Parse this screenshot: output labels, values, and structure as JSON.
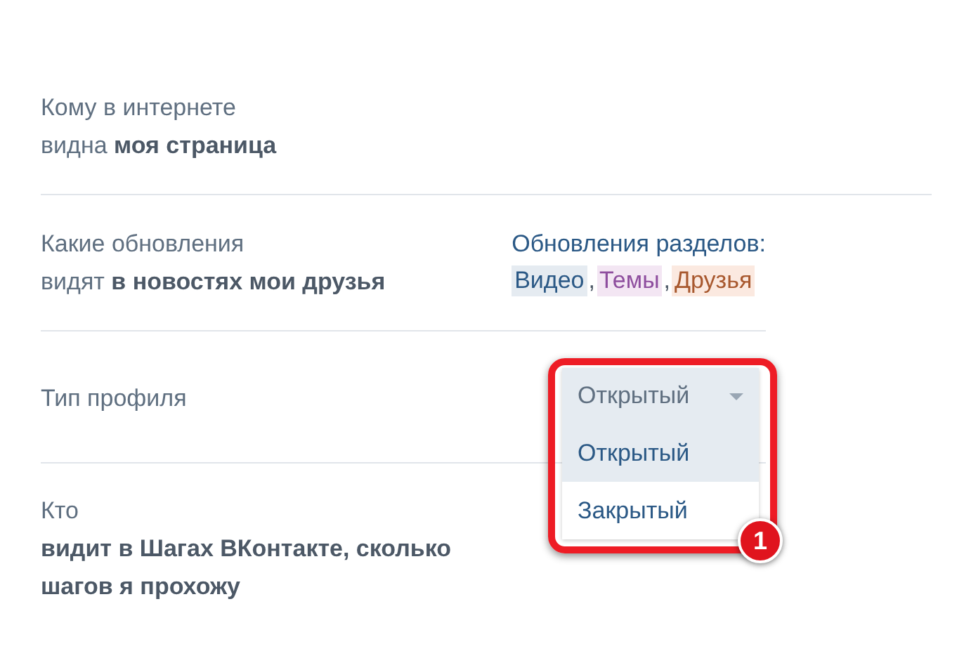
{
  "settings": [
    {
      "label_lines": [
        "Кому в интернете",
        "видна **моя страница**"
      ]
    },
    {
      "label_lines": [
        "Какие обновления",
        "видят **в новостях мои друзья**"
      ],
      "value": {
        "kind": "tags",
        "title": "Обновления разделов:",
        "separator": ",",
        "tags": [
          {
            "text": "Видео",
            "color": "#2a5885"
          },
          {
            "text": "Темы",
            "color": "#8e4e9e"
          },
          {
            "text": "Друзья",
            "color": "#a8582e"
          }
        ]
      }
    },
    {
      "label_lines": [
        "Тип профиля"
      ],
      "value": {
        "kind": "dropdown",
        "current": "Открытый",
        "expanded": true,
        "options": [
          {
            "text": "Открытый",
            "selected": true
          },
          {
            "text": "Закрытый",
            "selected": false
          }
        ]
      }
    },
    {
      "label_lines": [
        "Кто",
        "**видит в Шагах ВКонтакте, сколько**",
        "**шагов я прохожу**"
      ]
    }
  ],
  "annotation": {
    "badge": "1"
  }
}
